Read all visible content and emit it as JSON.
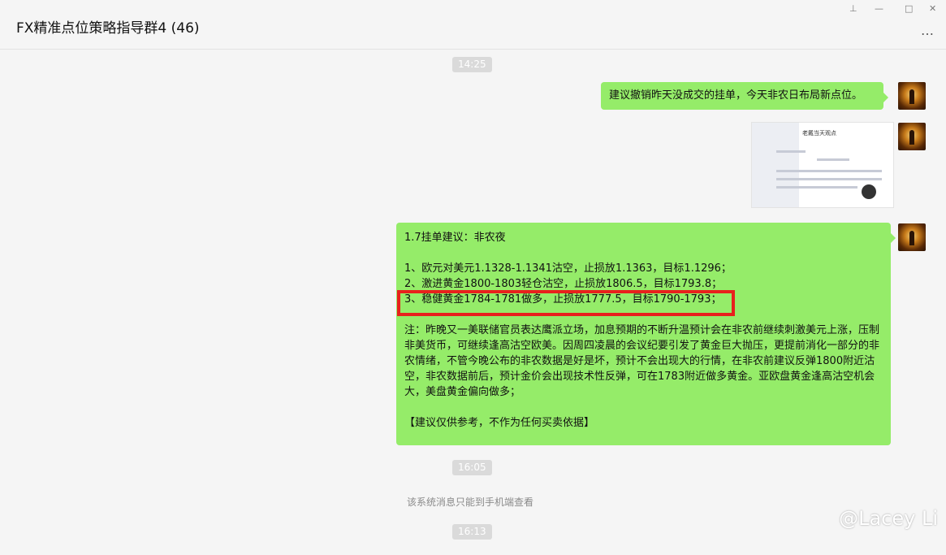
{
  "window": {
    "title": "FX精准点位策略指导群4 (46)",
    "controls": [
      "⊥",
      "—",
      "□",
      "✕"
    ],
    "more": "…"
  },
  "chat": {
    "time1": "14:25",
    "msg1": "建议撤销昨天没成交的挂单，今天非农日布局新点位。",
    "image": {
      "title": "老戴当天观点"
    },
    "msg3": {
      "lines": [
        "1.7挂单建议：非农夜",
        "1、欧元对美元1.1328-1.1341沽空，止损放1.1363，目标1.1296；",
        "2、激进黄金1800-1803轻仓沽空，止损放1806.5，目标1793.8；",
        "3、稳健黄金1784-1781做多，止损放1777.5，目标1790-1793；"
      ],
      "note": "注：昨晚又一美联储官员表达鹰派立场，加息预期的不断升温预计会在非农前继续刺激美元上涨，压制非美货币，可继续逢高沽空欧美。因周四凌晨的会议纪要引发了黄金巨大抛压，更提前消化一部分的非农情绪，不管今晚公布的非农数据是好是坏，预计不会出现大的行情，在非农前建议反弹1800附近沽空，非农数据前后，预计金价会出现技术性反弹，可在1783附近做多黄金。亚欧盘黄金逢高沽空机会大，美盘黄金偏向做多；",
      "disclaimer": "【建议仅供参考，不作为任何买卖依据】"
    },
    "time2": "16:05",
    "system_message": "该系统消息只能到手机端查看",
    "time3": "16:13"
  },
  "watermark": "@Lacey Li",
  "colors": {
    "bubble": "#95ec69",
    "highlight": "#e8211c",
    "background": "#f5f5f5"
  }
}
